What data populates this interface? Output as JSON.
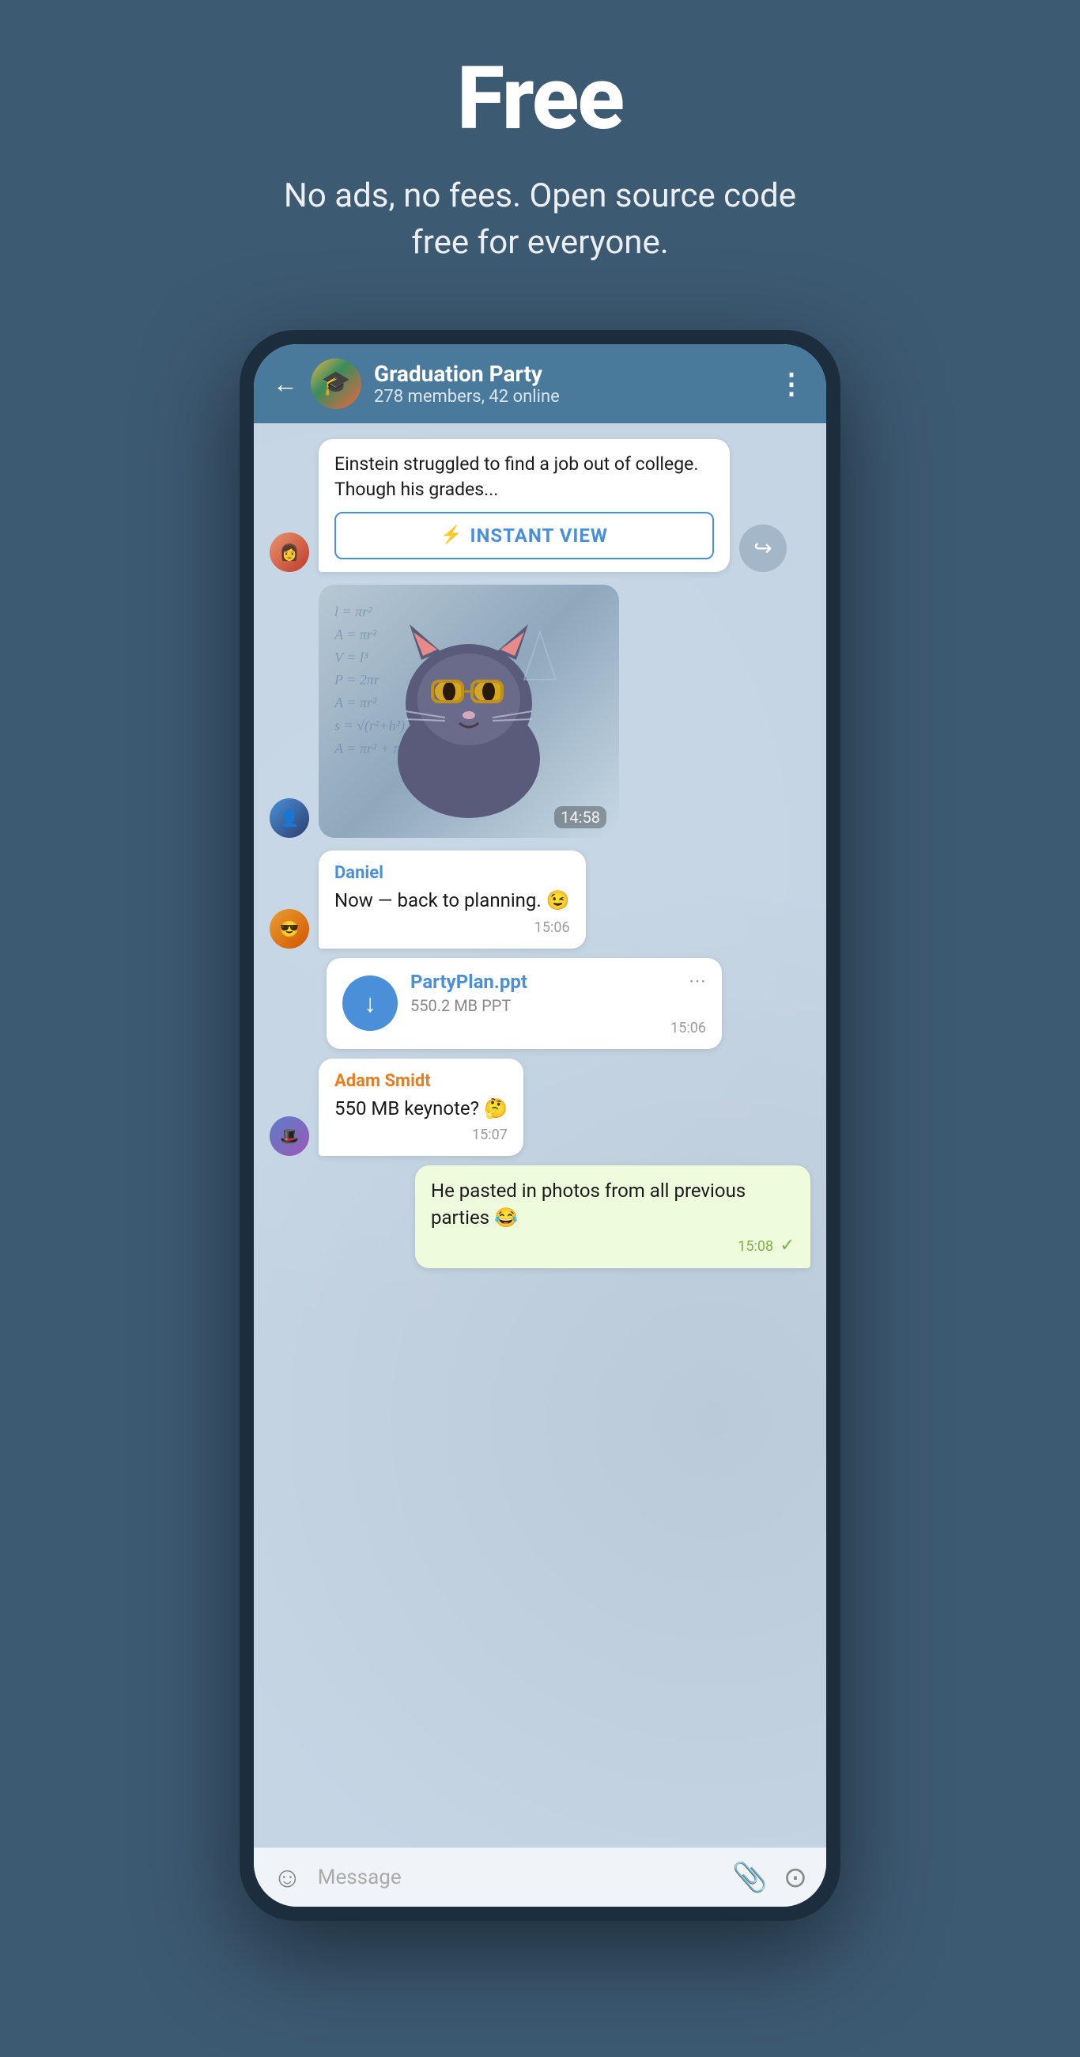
{
  "page": {
    "hero_title": "Free",
    "hero_subtitle": "No ads, no fees. Open source code free for everyone."
  },
  "phone": {
    "header": {
      "back_label": "←",
      "chat_name": "Graduation Party",
      "chat_meta": "278 members, 42 online",
      "menu_icon": "⋮"
    },
    "messages": [
      {
        "id": "article",
        "type": "article",
        "text": "Einstein struggled to find a job out of college. Though his grades...",
        "instant_view_label": "INSTANT VIEW",
        "avatar_class": "avatar1"
      },
      {
        "id": "sticker",
        "type": "sticker",
        "time": "14:58",
        "avatar_class": "avatar2"
      },
      {
        "id": "daniel-msg",
        "type": "text",
        "sender": "Daniel",
        "text": "Now — back to planning. 😉",
        "time": "15:06",
        "avatar_class": "avatar3"
      },
      {
        "id": "file-msg",
        "type": "file",
        "file_name": "PartyPlan.ppt",
        "file_size": "550.2 MB PPT",
        "time": "15:06",
        "avatar_class": "avatar3"
      },
      {
        "id": "adam-msg",
        "type": "text",
        "sender": "Adam Smidt",
        "text": "550 MB keynote? 🤔",
        "time": "15:07",
        "avatar_class": "avatar4"
      },
      {
        "id": "self-msg",
        "type": "self",
        "text": "He pasted in photos from all previous parties 😂",
        "time": "15:08"
      }
    ],
    "input_bar": {
      "placeholder": "Message",
      "emoji_icon": "☺",
      "attach_icon": "📎",
      "camera_icon": "⊙"
    }
  }
}
